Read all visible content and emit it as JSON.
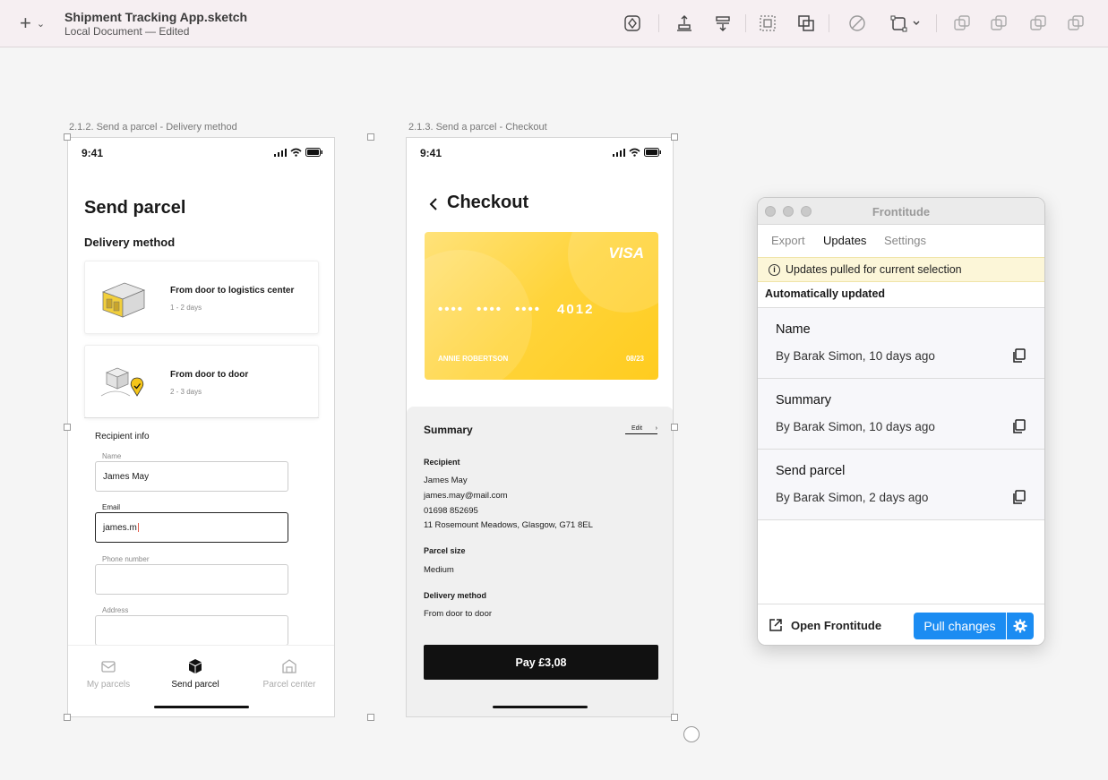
{
  "toolbar": {
    "doc_title": "Shipment Tracking App.sketch",
    "doc_subtitle": "Local Document — Edited",
    "icons": [
      "plus-icon",
      "symbol-icon",
      "send-backward-icon",
      "bring-forward-icon",
      "group-icon",
      "ungroup-icon",
      "mask-icon",
      "resize-icon",
      "union-icon",
      "subtract-icon",
      "intersect-icon",
      "difference-icon"
    ]
  },
  "artboard1": {
    "label": "2.1.2. Send a parcel - Delivery method",
    "time": "9:41",
    "title": "Send parcel",
    "subtitle": "Delivery method",
    "options": [
      {
        "title": "From door to logistics center",
        "duration": "1 - 2 days"
      },
      {
        "title": "From door to door",
        "duration": "2 - 3 days"
      }
    ],
    "recipient_title": "Recipient info",
    "fields": {
      "name_label": "Name",
      "name_value": "James May",
      "email_label": "Email",
      "email_value": "james.m",
      "phone_label": "Phone number",
      "address_label": "Address"
    },
    "tabs": [
      "My parcels",
      "Send parcel",
      "Parcel center"
    ]
  },
  "artboard2": {
    "label": "2.1.3. Send a parcel - Checkout",
    "time": "9:41",
    "title": "Checkout",
    "card": {
      "brand": "VISA",
      "groups": [
        "••••",
        "••••",
        "••••",
        "4012"
      ],
      "holder": "ANNIE ROBERTSON",
      "expiry": "08/23",
      "color": "#ffd43a"
    },
    "summary": {
      "title": "Summary",
      "edit": "Edit",
      "recipient_h": "Recipient",
      "recipient_lines": [
        "James May",
        "james.may@mail.com",
        "01698 852695",
        "11 Rosemount Meadows, Glasgow, G71 8EL"
      ],
      "size_h": "Parcel size",
      "size_v": "Medium",
      "method_h": "Delivery method",
      "method_v": "From door to door"
    },
    "pay_label": "Pay £3,08"
  },
  "panel": {
    "title": "Frontitude",
    "tabs": [
      "Export",
      "Updates",
      "Settings"
    ],
    "active_tab": "Updates",
    "notice": "Updates pulled for current selection",
    "section": "Automatically updated",
    "items": [
      {
        "name": "Name",
        "meta": "By Barak Simon, 10 days ago"
      },
      {
        "name": "Summary",
        "meta": "By Barak Simon, 10 days ago"
      },
      {
        "name": "Send parcel",
        "meta": "By Barak Simon, 2 days ago"
      }
    ],
    "open_label": "Open Frontitude",
    "pull_label": "Pull changes",
    "accent": "#1b8cf2"
  }
}
